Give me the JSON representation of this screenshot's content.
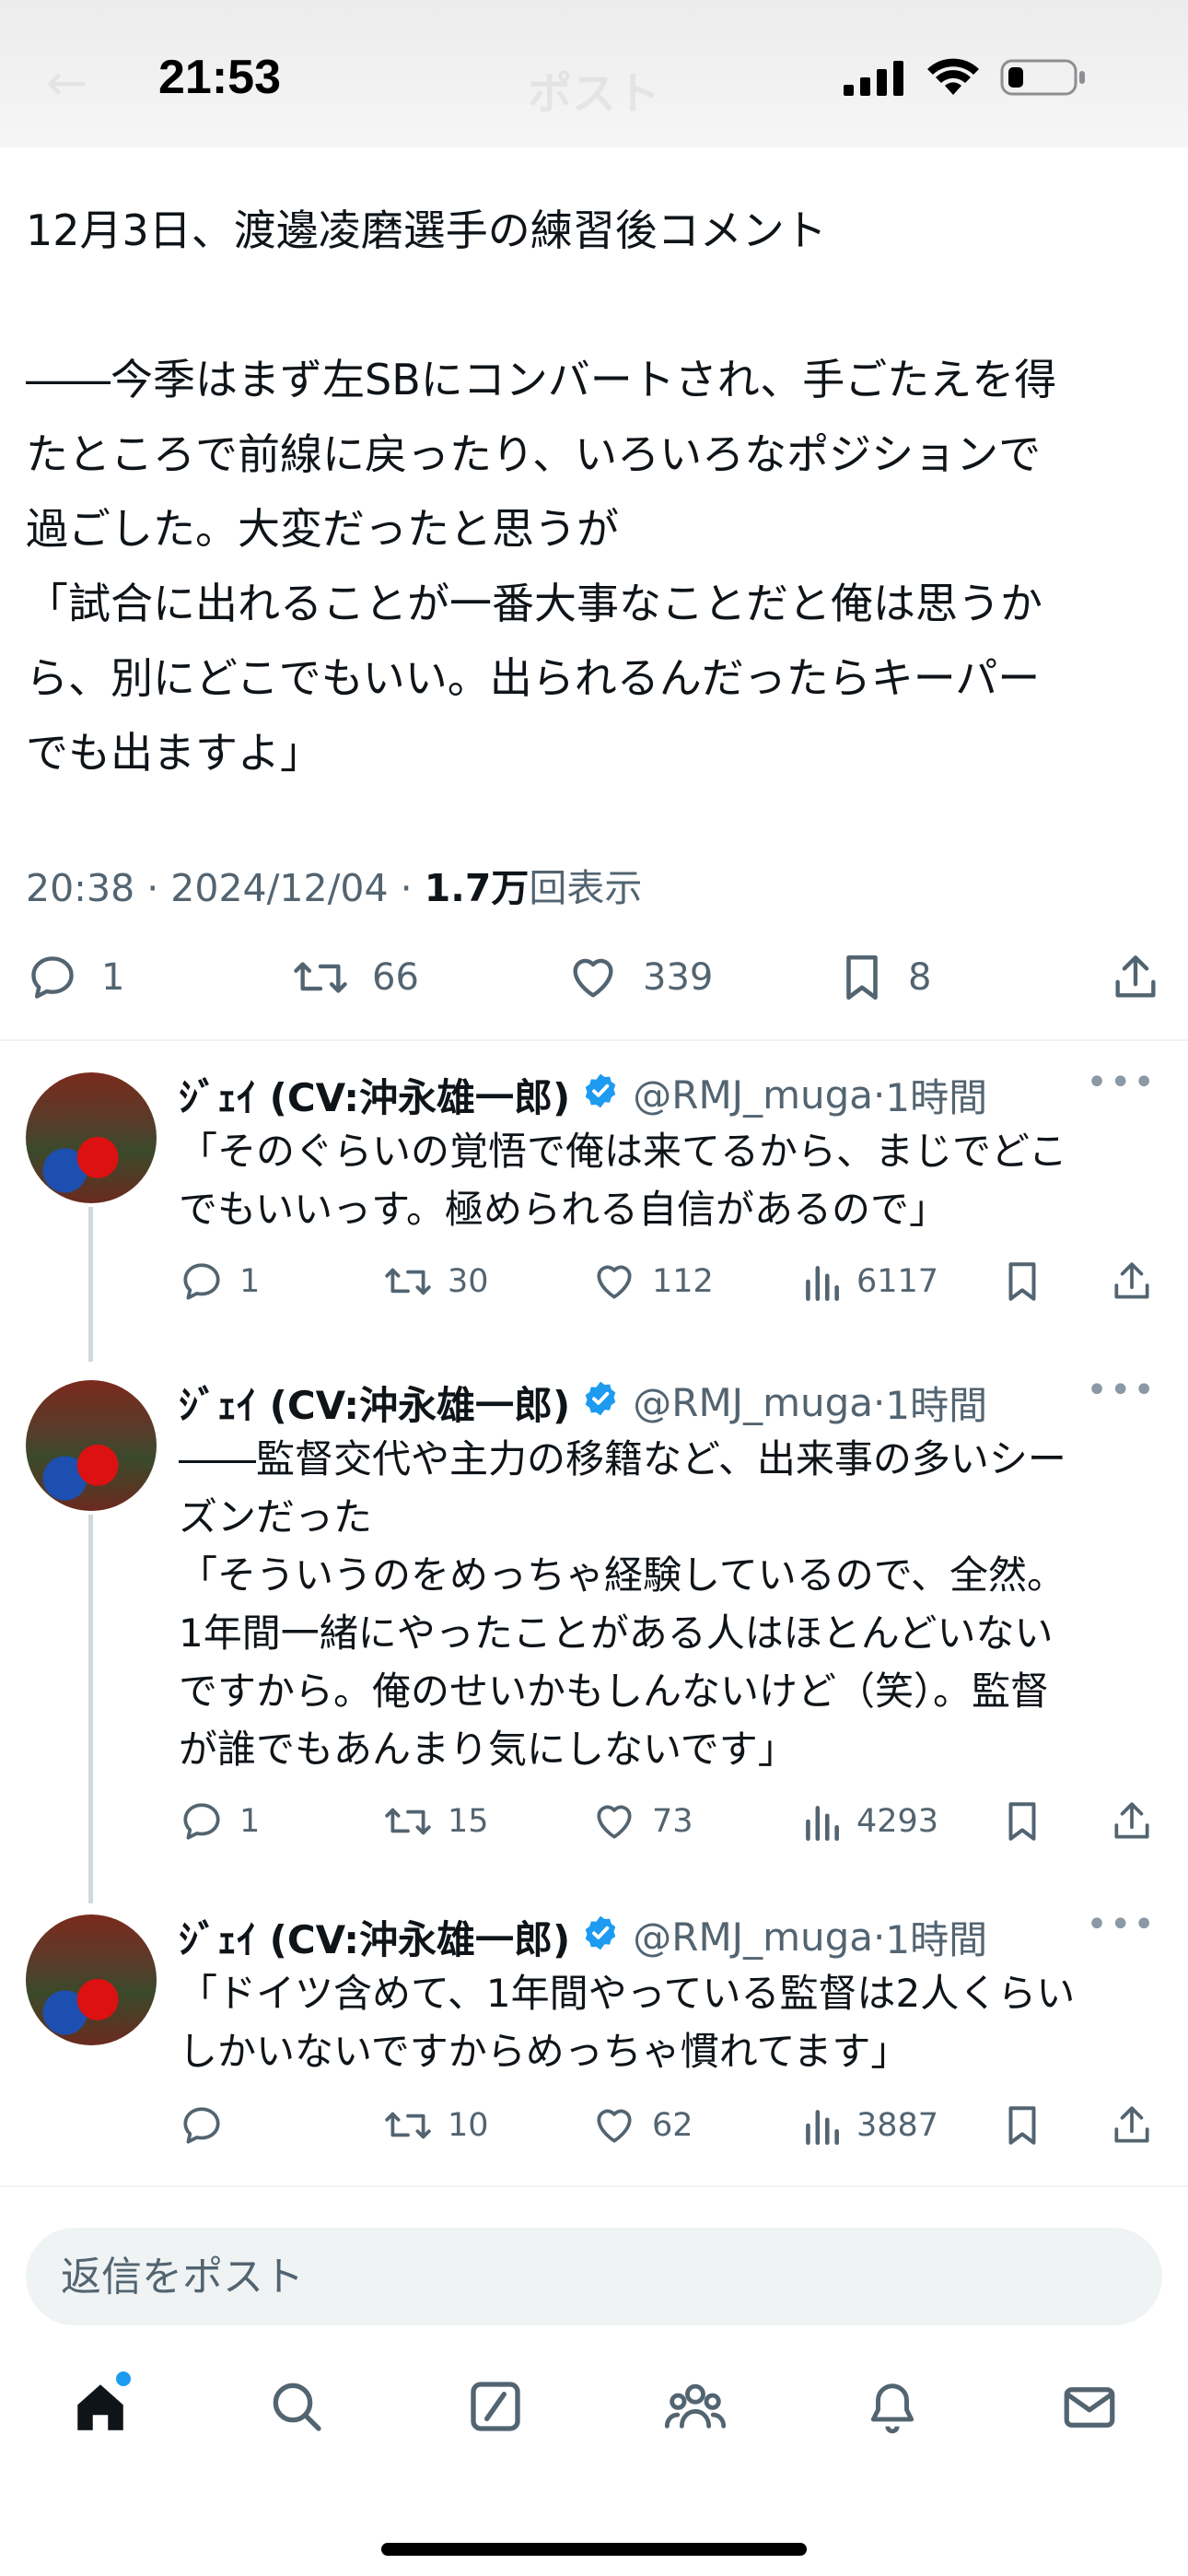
{
  "status_bar": {
    "time": "21:53",
    "header_title": "ポスト"
  },
  "main_post": {
    "text": "12月3日、渡邊凌磨選手の練習後コメント\n\n――今季はまず左SBにコンバートされ、手ごたえを得\nたところで前線に戻ったり、いろいろなポジションで\n過ごした。大変だったと思うが\n「試合に出れることが一番大事なことだと俺は思うか\nら、別にどこでもいい。出られるんだったらキーパー\nでも出ますよ」",
    "time": "20:38",
    "date": "2024/12/04",
    "views_count": "1.7万",
    "views_label": "回表示",
    "replies": "1",
    "reposts": "66",
    "likes": "339",
    "bookmarks": "8"
  },
  "replies": [
    {
      "name": "ｼﾞｪｲ (CV:沖永雄一郎)",
      "handle": "@RMJ_muga",
      "time": "1時間",
      "text": "「そのぐらいの覚悟で俺は来てるから、まじでどこ\nでもいいっす。極められる自信があるので」",
      "replies": "1",
      "reposts": "30",
      "likes": "112",
      "views": "6117"
    },
    {
      "name": "ｼﾞｪｲ (CV:沖永雄一郎)",
      "handle": "@RMJ_muga",
      "time": "1時間",
      "text": "――監督交代や主力の移籍など、出来事の多いシー\nズンだった\n「そういうのをめっちゃ経験しているので、全然。\n1年間一緒にやったことがある人はほとんどいない\nですから。俺のせいかもしんないけど（笑）。監督\nが誰でもあんまり気にしないです」",
      "replies": "1",
      "reposts": "15",
      "likes": "73",
      "views": "4293"
    },
    {
      "name": "ｼﾞｪｲ (CV:沖永雄一郎)",
      "handle": "@RMJ_muga",
      "time": "1時間",
      "text": "「ドイツ含めて、1年間やっている監督は2人くらい\nしかいないですからめっちゃ慣れてます」",
      "replies": "",
      "reposts": "10",
      "likes": "62",
      "views": "3887"
    }
  ],
  "composer": {
    "placeholder": "返信をポスト"
  },
  "colors": {
    "accent": "#1d9bf0",
    "text": "#0f1419",
    "muted": "#536471",
    "divider": "#eff3f4",
    "verified": "#1d9bf0"
  },
  "icons": {
    "tabbar": [
      "home-icon",
      "search-icon",
      "grok-icon",
      "communities-icon",
      "notifications-icon",
      "messages-icon"
    ],
    "actions": [
      "reply-icon",
      "repost-icon",
      "like-icon",
      "views-icon",
      "bookmark-icon",
      "share-icon"
    ]
  }
}
